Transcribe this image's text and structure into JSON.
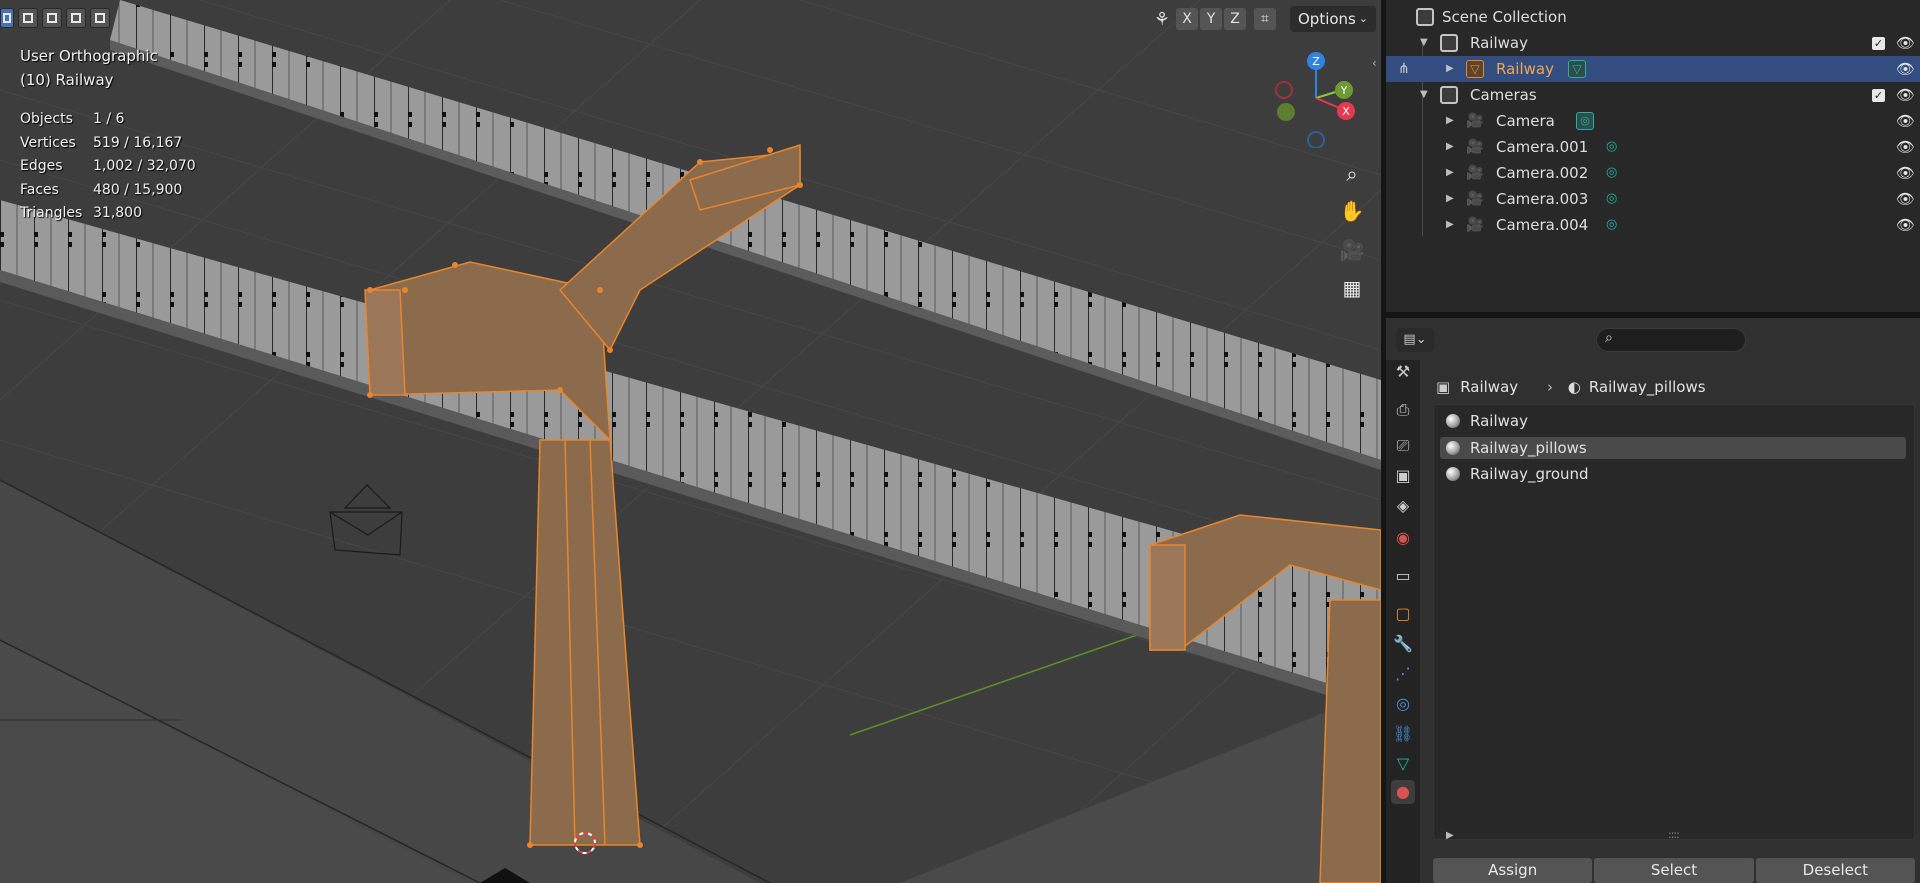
{
  "viewport": {
    "view_name": "User Orthographic",
    "object_context": "(10) Railway",
    "stats": [
      {
        "label": "Objects",
        "value": "1 / 6"
      },
      {
        "label": "Vertices",
        "value": "519 / 16,167"
      },
      {
        "label": "Edges",
        "value": "1,002 / 32,070"
      },
      {
        "label": "Faces",
        "value": "480 / 15,900"
      },
      {
        "label": "Triangles",
        "value": "31,800"
      }
    ],
    "header": {
      "axis_buttons": [
        "X",
        "Y",
        "Z"
      ],
      "options_label": "Options"
    },
    "gizmo": {
      "z_label": "Z",
      "y_label": "Y",
      "x_label": "X"
    }
  },
  "outliner": {
    "root": "Scene Collection",
    "items": [
      {
        "name": "Railway",
        "type": "collection"
      },
      {
        "name": "Railway",
        "type": "mesh",
        "selected": true
      },
      {
        "name": "Cameras",
        "type": "collection"
      },
      {
        "name": "Camera",
        "type": "camera"
      },
      {
        "name": "Camera.001",
        "type": "camera"
      },
      {
        "name": "Camera.002",
        "type": "camera"
      },
      {
        "name": "Camera.003",
        "type": "camera"
      },
      {
        "name": "Camera.004",
        "type": "camera"
      }
    ]
  },
  "properties": {
    "breadcrumb": {
      "object": "Railway",
      "material": "Railway_pillows"
    },
    "materials": [
      {
        "name": "Railway",
        "selected": false
      },
      {
        "name": "Railway_pillows",
        "selected": true
      },
      {
        "name": "Railway_ground",
        "selected": false
      }
    ],
    "buttons": {
      "assign": "Assign",
      "select": "Select",
      "deselect": "Deselect"
    }
  },
  "colors": {
    "selection_orange": "#e8862c",
    "outliner_selected": "#334d80",
    "axis_x": "#e8384f",
    "axis_y": "#8bc63f",
    "axis_z": "#2f83e3"
  }
}
